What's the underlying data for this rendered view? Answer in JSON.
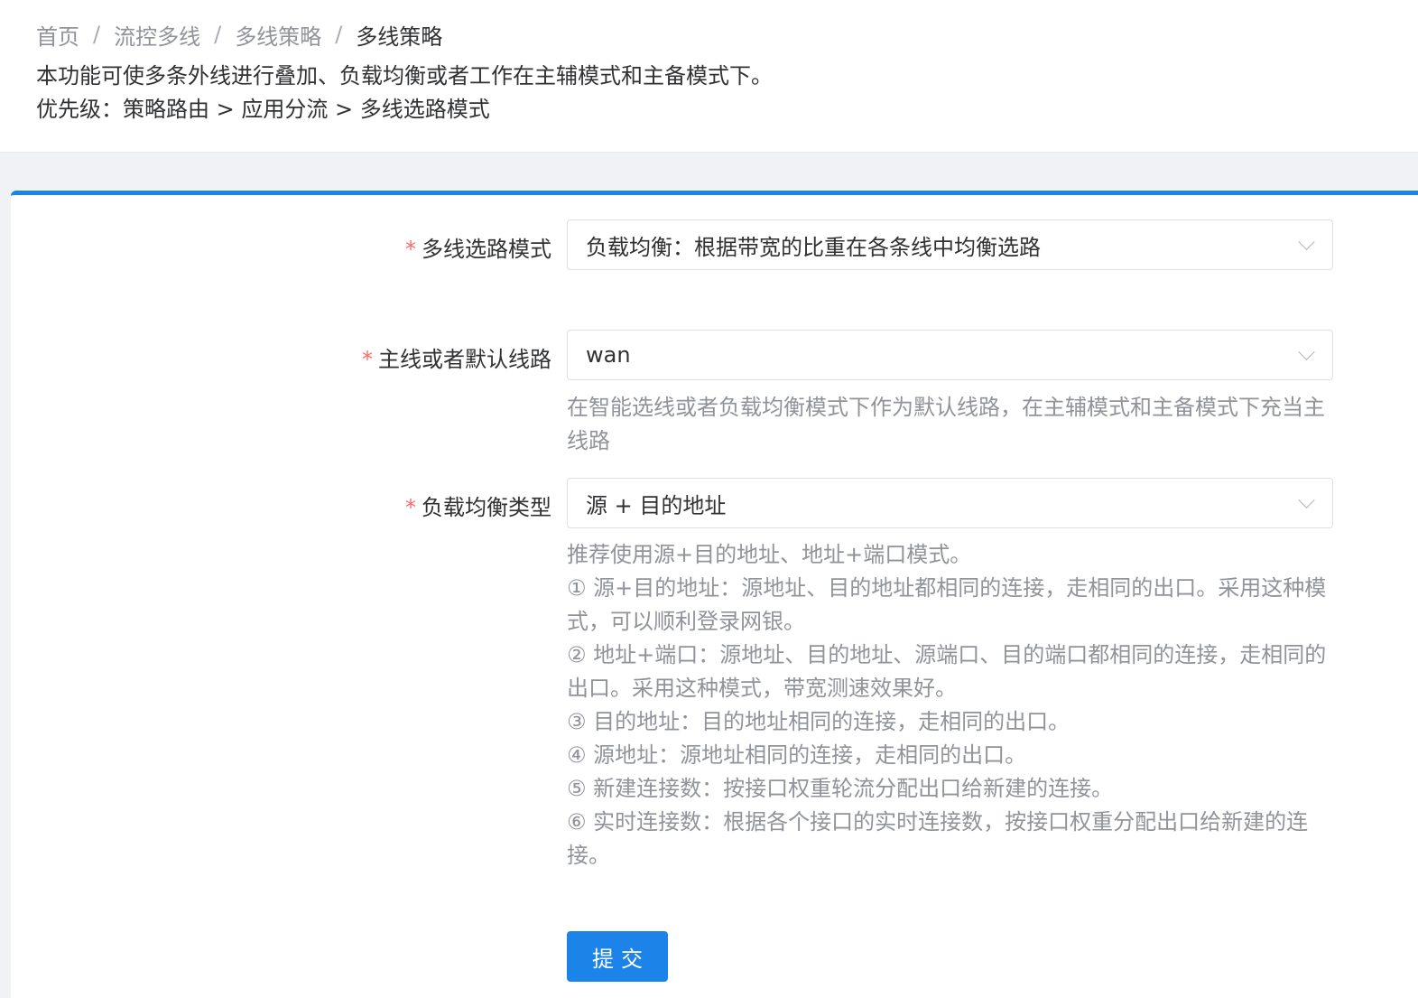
{
  "breadcrumb": {
    "items": [
      "首页",
      "流控多线",
      "多线策略",
      "多线策略"
    ],
    "separator": "/"
  },
  "description": {
    "line1": "本功能可使多条外线进行叠加、负载均衡或者工作在主辅模式和主备模式下。",
    "line2": "优先级：策略路由 > 应用分流 > 多线选路模式"
  },
  "form": {
    "required_mark": "*",
    "mode": {
      "label": "多线选路模式",
      "value": "负载均衡：根据带宽的比重在各条线中均衡选路"
    },
    "default_line": {
      "label": "主线或者默认线路",
      "value": "wan",
      "help": "在智能选线或者负载均衡模式下作为默认线路，在主辅模式和主备模式下充当主线路"
    },
    "lb_type": {
      "label": "负载均衡类型",
      "value": "源 + 目的地址",
      "help": [
        "推荐使用源+目的地址、地址+端口模式。",
        "① 源+目的地址：源地址、目的地址都相同的连接，走相同的出口。采用这种模式，可以顺利登录网银。",
        "② 地址+端口：源地址、目的地址、源端口、目的端口都相同的连接，走相同的出口。采用这种模式，带宽测速效果好。",
        "③ 目的地址：目的地址相同的连接，走相同的出口。",
        "④ 源地址：源地址相同的连接，走相同的出口。",
        "⑤ 新建连接数：按接口权重轮流分配出口给新建的连接。",
        "⑥ 实时连接数：根据各个接口的实时连接数，按接口权重分配出口给新建的连接。"
      ]
    },
    "submit_label": "提交"
  },
  "colors": {
    "primary": "#1c84e8",
    "required": "#f56c6c",
    "help_text": "#909399",
    "page_bg": "#f0f2f5"
  },
  "icons": {
    "select_arrow": "chevron-down-icon"
  }
}
